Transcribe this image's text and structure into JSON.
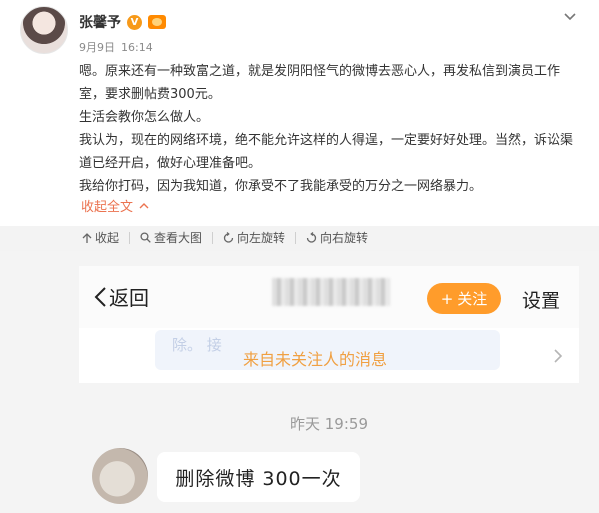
{
  "post": {
    "username": "张馨予",
    "date": "9月9日",
    "time": "16:14",
    "paragraphs": [
      "嗯。原来还有一种致富之道，就是发阴阳怪气的微博去恶心人，再发私信到演员工作室，要求删帖费300元。",
      "生活会教你怎么做人。",
      "我认为，现在的网络环境，绝不能允许这样的人得逞，一定要好好处理。当然，诉讼渠道已经开启，做好心理准备吧。",
      "我给你打码，因为我知道，你承受不了我能承受的万分之一网络暴力。"
    ],
    "collapse_label": "收起全文",
    "verified_icon": "V-icon",
    "member_icon": "vip-icon"
  },
  "toolbar": {
    "collapse": "收起",
    "view_large": "查看大图",
    "rotate_left": "向左旋转",
    "rotate_right": "向右旋转"
  },
  "chat_screenshot": {
    "back_label": "返回",
    "follow_label": "关注",
    "settings_label": "设置",
    "notice_label": "来自未关注人的消息",
    "ghost_text": "除。 接",
    "timestamp": "昨天 19:59",
    "message": "删除微博 300一次"
  },
  "colors": {
    "accent": "#eb7350",
    "follow_button": "#ff9c2b",
    "notice_text": "#f0a042",
    "verified_badge": "#f79a1a"
  }
}
